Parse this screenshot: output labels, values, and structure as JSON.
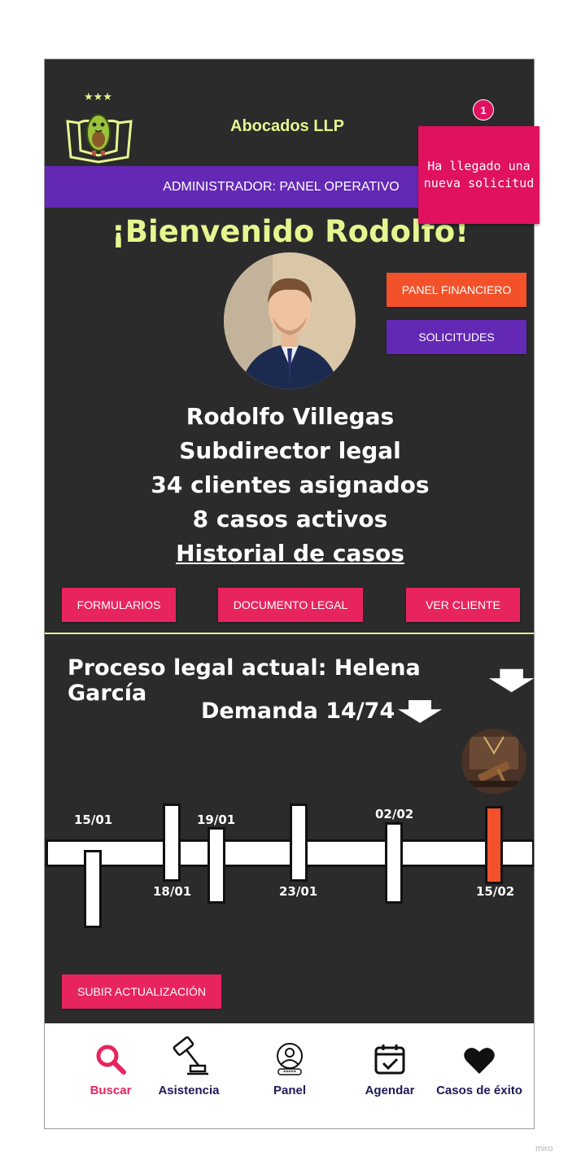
{
  "app": {
    "name": "Abocados LLP"
  },
  "notification": {
    "count": "1",
    "message": "Ha llegado una nueva solicitud"
  },
  "banner": {
    "title": "ADMINISTRADOR: PANEL OPERATIVO"
  },
  "welcome": "¡Bienvenido Rodolfo!",
  "side_buttons": {
    "finance": "PANEL FINANCIERO",
    "requests": "SOLICITUDES"
  },
  "profile": {
    "name": "Rodolfo Villegas",
    "role": "Subdirector legal",
    "clients": "34 clientes asignados",
    "cases": "8 casos activos",
    "history_link": "Historial de casos"
  },
  "actions": {
    "forms": "FORMULARIOS",
    "legal_doc": "DOCUMENTO LEGAL",
    "view_client": "VER CLIENTE"
  },
  "process": {
    "title": "Proceso legal actual: Helena García",
    "lawsuit": "Demanda 14/74"
  },
  "timeline": {
    "dates_above": [
      "15/01",
      "19/01",
      "02/02"
    ],
    "dates_below": [
      "18/01",
      "23/01",
      "15/02"
    ],
    "upload_button": "SUBIR ACTUALIZACIÓN"
  },
  "nav": {
    "items": [
      {
        "label": "Buscar",
        "icon": "search-icon",
        "active": true
      },
      {
        "label": "Asistencia",
        "icon": "gavel-icon",
        "active": false
      },
      {
        "label": "Panel",
        "icon": "user-panel-icon",
        "active": false
      },
      {
        "label": "Agendar",
        "icon": "calendar-check-icon",
        "active": false
      },
      {
        "label": "Casos de éxito",
        "icon": "heart-icon",
        "active": false
      }
    ]
  },
  "colors": {
    "background": "#2b2b2b",
    "accent_pink": "#e8245f",
    "accent_purple": "#6328b4",
    "accent_orange": "#f2512a",
    "brand_yellow": "#e6f58f",
    "notification": "#e0115f"
  },
  "watermark": "miro"
}
